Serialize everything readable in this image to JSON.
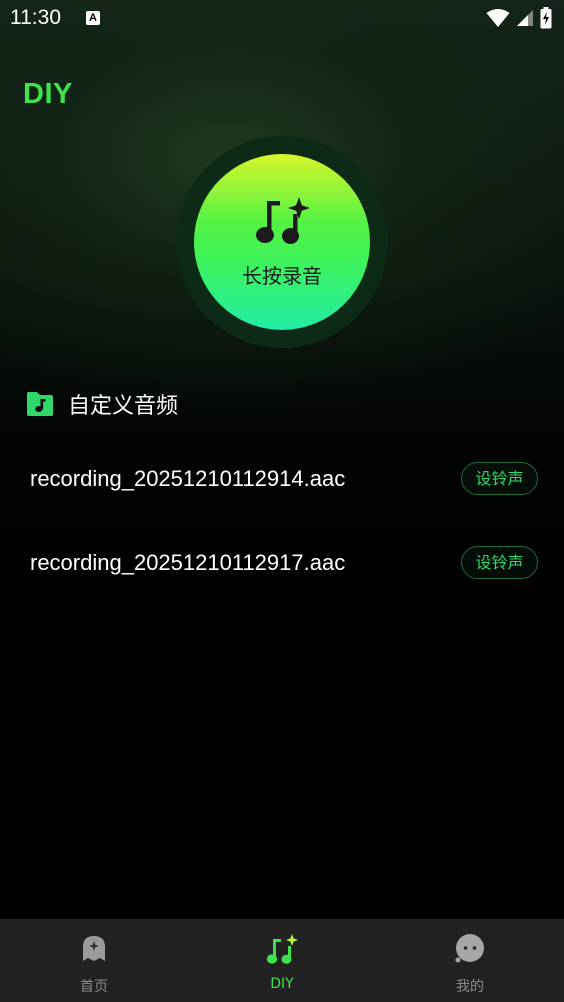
{
  "status_bar": {
    "time": "11:30",
    "notification_letter": "A"
  },
  "page": {
    "title": "DIY"
  },
  "record": {
    "label": "长按录音"
  },
  "section": {
    "title": "自定义音频"
  },
  "recordings": [
    {
      "file_name": "recording_20251210112914.aac",
      "action_label": "设铃声"
    },
    {
      "file_name": "recording_20251210112917.aac",
      "action_label": "设铃声"
    }
  ],
  "bottom_nav": {
    "items": [
      {
        "label": "首页",
        "icon": "ghost-home-icon",
        "active": false
      },
      {
        "label": "DIY",
        "icon": "music-note-sparkle-icon",
        "active": true
      },
      {
        "label": "我的",
        "icon": "face-profile-icon",
        "active": false
      }
    ]
  },
  "colors": {
    "accent": "#3ee24d",
    "action_text": "#2fd868",
    "nav_bg": "#222222"
  }
}
